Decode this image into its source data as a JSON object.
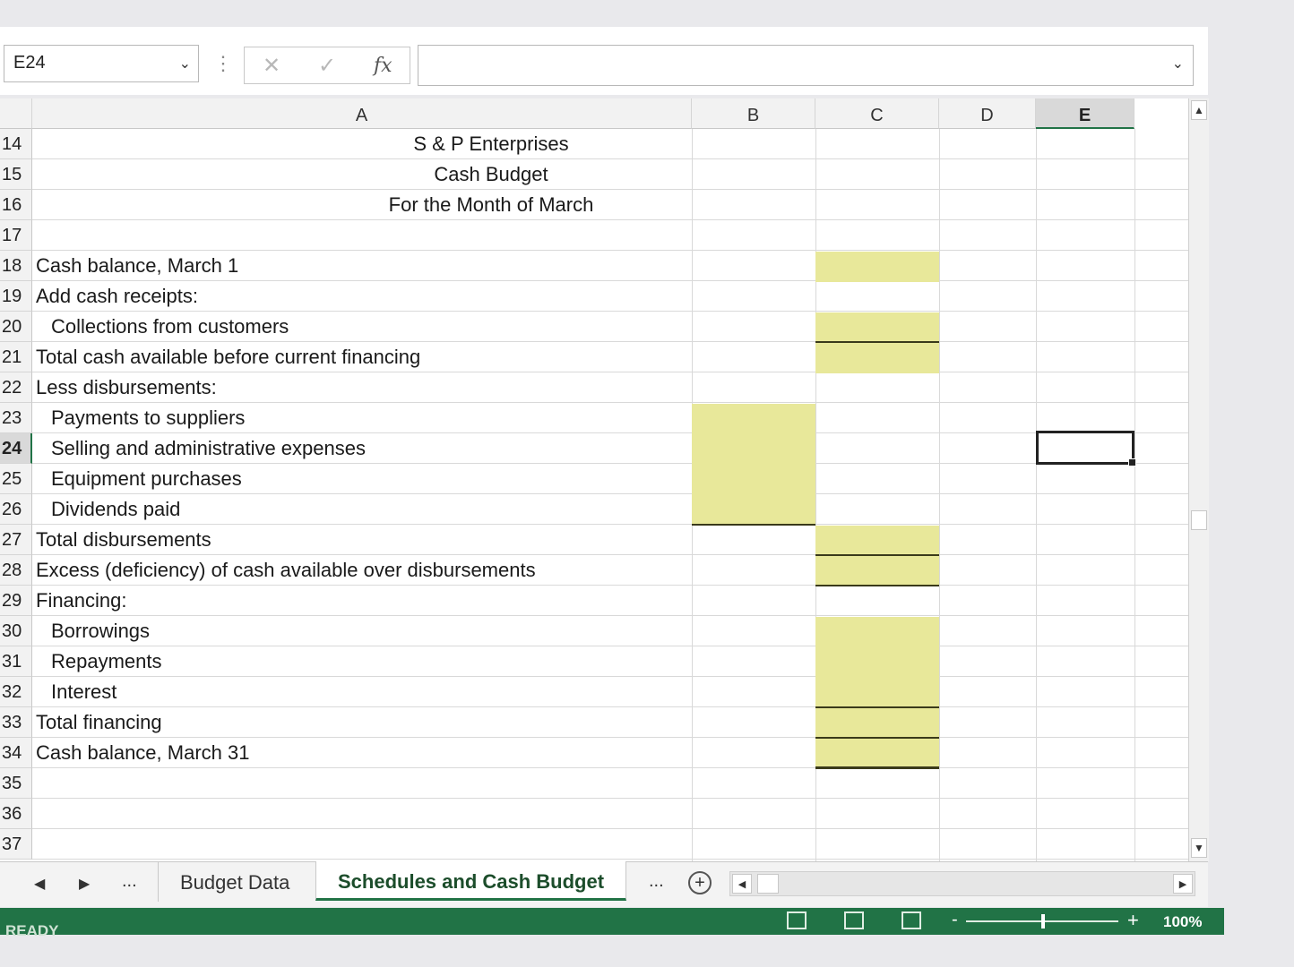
{
  "namebox": {
    "value": "E24",
    "chevron": "chevron-down-icon"
  },
  "formula": {
    "cancel_icon": "✕",
    "enter_icon": "✓",
    "fx_label": "fx",
    "value": ""
  },
  "columns": [
    "A",
    "B",
    "C",
    "D",
    "E"
  ],
  "selected_column": "E",
  "rows": [
    {
      "num": "14",
      "text": "S & P Enterprises",
      "style": "center"
    },
    {
      "num": "15",
      "text": "Cash Budget",
      "style": "center"
    },
    {
      "num": "16",
      "text": "For the Month of March",
      "style": "center"
    },
    {
      "num": "17",
      "text": "",
      "style": ""
    },
    {
      "num": "18",
      "text": "Cash balance, March 1",
      "style": ""
    },
    {
      "num": "19",
      "text": "Add cash receipts:",
      "style": ""
    },
    {
      "num": "20",
      "text": "Collections from customers",
      "style": "indent"
    },
    {
      "num": "21",
      "text": "Total cash available before current financing",
      "style": ""
    },
    {
      "num": "22",
      "text": "Less disbursements:",
      "style": ""
    },
    {
      "num": "23",
      "text": "Payments to suppliers",
      "style": "indent"
    },
    {
      "num": "24",
      "text": "Selling and administrative expenses",
      "style": "indent"
    },
    {
      "num": "25",
      "text": "Equipment purchases",
      "style": "indent"
    },
    {
      "num": "26",
      "text": "Dividends paid",
      "style": "indent"
    },
    {
      "num": "27",
      "text": "Total disbursements",
      "style": ""
    },
    {
      "num": "28",
      "text": "Excess (deficiency) of cash available over disbursements",
      "style": ""
    },
    {
      "num": "29",
      "text": "Financing:",
      "style": ""
    },
    {
      "num": "30",
      "text": "Borrowings",
      "style": "indent"
    },
    {
      "num": "31",
      "text": "Repayments",
      "style": "indent"
    },
    {
      "num": "32",
      "text": "Interest",
      "style": "indent"
    },
    {
      "num": "33",
      "text": "Total financing",
      "style": ""
    },
    {
      "num": "34",
      "text": "Cash balance, March 31",
      "style": ""
    },
    {
      "num": "35",
      "text": "",
      "style": ""
    },
    {
      "num": "36",
      "text": "",
      "style": ""
    },
    {
      "num": "37",
      "text": "",
      "style": ""
    }
  ],
  "selected_row": "24",
  "tabs": {
    "prev": "◀",
    "next": "▶",
    "more_left": "...",
    "items": [
      {
        "label": "Budget Data",
        "active": false
      },
      {
        "label": "Schedules and Cash Budget",
        "active": true
      }
    ],
    "more_right": "...",
    "add": "+"
  },
  "status": {
    "text": "READY",
    "zoom": "100%",
    "zoom_minus": "-",
    "zoom_plus": "+"
  },
  "colors": {
    "input_cell": "#e8e89a",
    "excel_green": "#217346"
  }
}
